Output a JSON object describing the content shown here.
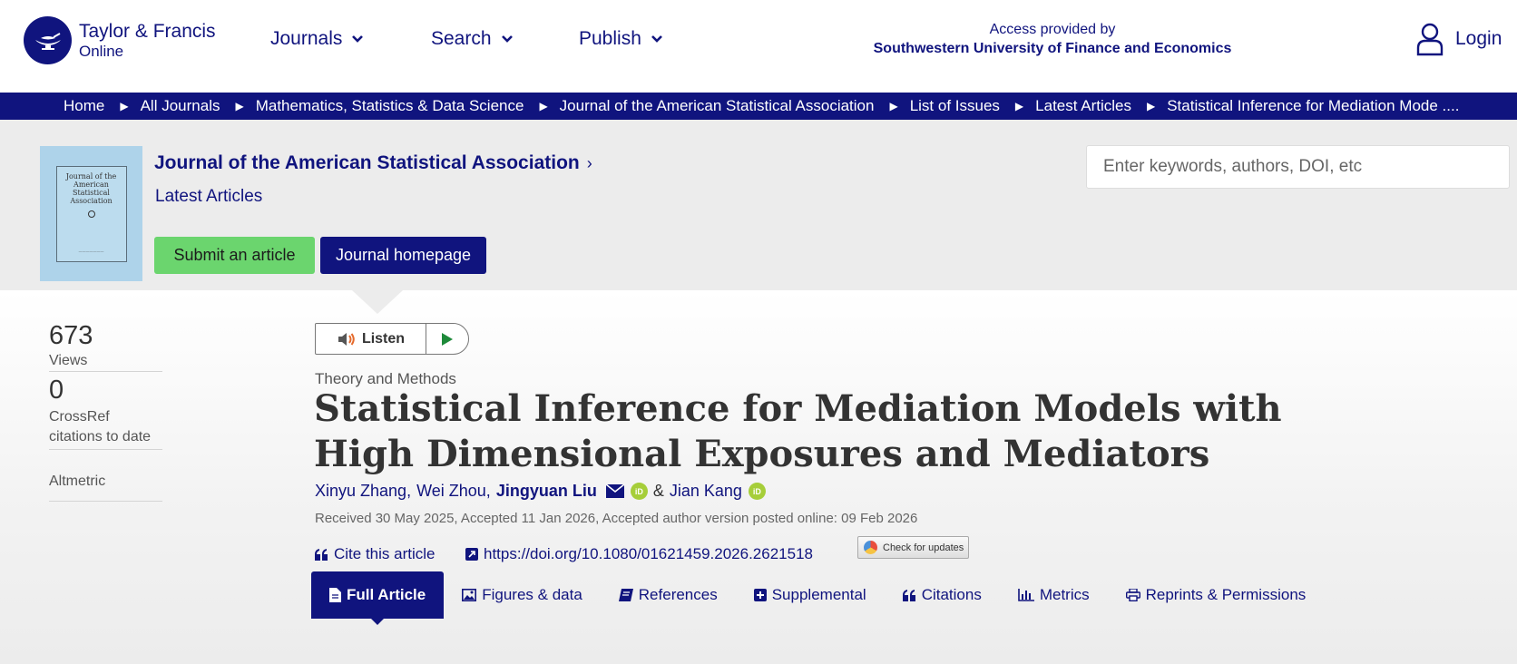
{
  "header": {
    "logo": {
      "line1": "Taylor & Francis",
      "line2": "Online"
    },
    "nav": [
      {
        "label": "Journals"
      },
      {
        "label": "Search"
      },
      {
        "label": "Publish"
      }
    ],
    "access": {
      "line1": "Access provided by",
      "line2": "Southwestern University of Finance and Economics"
    },
    "login_label": "Login"
  },
  "breadcrumb": [
    "Home",
    "All Journals",
    "Mathematics, Statistics & Data Science",
    "Journal of the American Statistical Association",
    "List of Issues",
    "Latest Articles",
    "Statistical Inference for Mediation Mode ...."
  ],
  "journal": {
    "cover_title": "Journal of the American Statistical Association",
    "name": "Journal of the American Statistical Association",
    "chevron": "›",
    "section": "Latest Articles",
    "submit_label": "Submit an article",
    "homepage_label": "Journal homepage"
  },
  "search": {
    "placeholder": "Enter keywords, authors, DOI, etc"
  },
  "metrics": {
    "views": {
      "value": "673",
      "label": "Views"
    },
    "crossref": {
      "value": "0",
      "label": "CrossRef citations to date"
    },
    "altmetric_label": "Altmetric"
  },
  "listen": {
    "label": "Listen"
  },
  "article": {
    "category": "Theory and Methods",
    "title": "Statistical Inference for Mediation Models with High Dimensional Exposures and Mediators",
    "authors": [
      {
        "name": "Xinyu Zhang",
        "sep": ","
      },
      {
        "name": "Wei Zhou",
        "sep": ","
      },
      {
        "name": "Jingyuan Liu"
      },
      {
        "name": "Jian Kang"
      }
    ],
    "amp": "&",
    "orcid_text": "iD",
    "dates": "Received 30 May 2025, Accepted 11 Jan 2026, Accepted author version posted online: 09 Feb 2026",
    "cite_label": "Cite this article",
    "doi": "https://doi.org/10.1080/01621459.2026.2621518",
    "updates_label": "Check for updates"
  },
  "tabs": [
    {
      "label": "Full Article",
      "icon": "document-icon",
      "active": true
    },
    {
      "label": "Figures & data",
      "icon": "image-icon"
    },
    {
      "label": "References",
      "icon": "book-icon"
    },
    {
      "label": "Supplemental",
      "icon": "plus-square-icon"
    },
    {
      "label": "Citations",
      "icon": "quote-icon"
    },
    {
      "label": "Metrics",
      "icon": "bar-chart-icon"
    },
    {
      "label": "Reprints & Permissions",
      "icon": "printer-icon"
    }
  ],
  "colors": {
    "brand_navy": "#10147e",
    "submit_green": "#6bd56e",
    "banner_grey": "#ececec",
    "orcid_green": "#a6ce39"
  }
}
